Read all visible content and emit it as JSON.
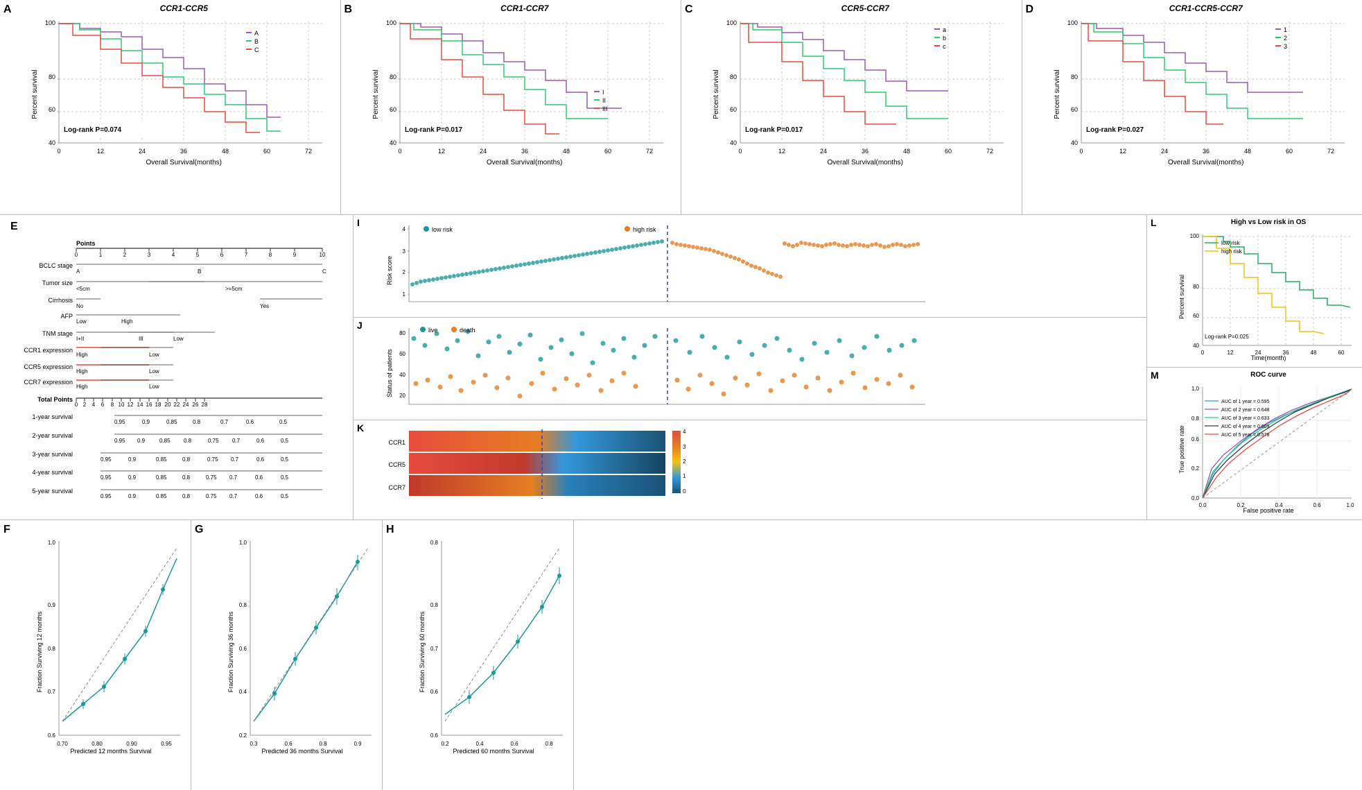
{
  "panels": {
    "A": {
      "label": "A",
      "title": "CCR1-CCR5",
      "pvalue": "Log-rank P=0.074",
      "xaxis": "Overall Survival(months)",
      "yaxis": "Percent survival",
      "legend": [
        "A",
        "B",
        "C"
      ],
      "legend_colors": [
        "#9b59b6",
        "#2ecc71",
        "#e74c3c"
      ],
      "xticks": [
        0,
        12,
        24,
        36,
        48,
        60,
        72
      ],
      "yticks": [
        40,
        60,
        80,
        100
      ]
    },
    "B": {
      "label": "B",
      "title": "CCR1-CCR7",
      "pvalue": "Log-rank P=0.017",
      "xaxis": "Overall Survival(months)",
      "yaxis": "Percent survival",
      "legend": [
        "I",
        "II",
        "III"
      ],
      "legend_colors": [
        "#9b59b6",
        "#2ecc71",
        "#e74c3c"
      ],
      "xticks": [
        0,
        12,
        24,
        36,
        48,
        60,
        72
      ],
      "yticks": [
        40,
        60,
        80,
        100
      ]
    },
    "C": {
      "label": "C",
      "title": "CCR5-CCR7",
      "pvalue": "Log-rank P=0.017",
      "xaxis": "Overall Survival(months)",
      "yaxis": "Percent survival",
      "legend": [
        "a",
        "b",
        "c"
      ],
      "legend_colors": [
        "#9b59b6",
        "#2ecc71",
        "#e74c3c"
      ],
      "xticks": [
        0,
        12,
        24,
        36,
        48,
        60,
        72
      ],
      "yticks": [
        40,
        60,
        80,
        100
      ]
    },
    "D": {
      "label": "D",
      "title": "CCR1-CCR5-CCR7",
      "pvalue": "Log-rank P=0.027",
      "xaxis": "Overall Survival(months)",
      "yaxis": "Percent survival",
      "legend": [
        "1",
        "2",
        "3"
      ],
      "legend_colors": [
        "#9b59b6",
        "#2ecc71",
        "#e74c3c"
      ],
      "xticks": [
        0,
        12,
        24,
        36,
        48,
        60,
        72
      ],
      "yticks": [
        40,
        60,
        80,
        100
      ]
    },
    "E": {
      "label": "E",
      "rows": [
        {
          "name": "Points",
          "scale": "0-10",
          "type": "scale"
        },
        {
          "name": "BCLC stage",
          "items": [
            "A",
            "B",
            "C"
          ],
          "type": "categorical"
        },
        {
          "name": "Tumor size",
          "items": [
            "<5cm",
            ">=5cm"
          ],
          "type": "categorical"
        },
        {
          "name": "Cirrhosis",
          "items": [
            "No",
            "Yes"
          ],
          "type": "categorical"
        },
        {
          "name": "AFP",
          "items": [
            "Low",
            "High"
          ],
          "type": "categorical"
        },
        {
          "name": "TNM stage",
          "items": [
            "I+II",
            "III"
          ],
          "type": "categorical"
        },
        {
          "name": "CCR1 expression",
          "items": [
            "High",
            "Low"
          ],
          "type": "categorical"
        },
        {
          "name": "CCR5 expression",
          "items": [
            "High",
            "Low"
          ],
          "type": "categorical"
        },
        {
          "name": "CCR7 expression",
          "items": [
            "High",
            "Low"
          ],
          "type": "categorical"
        },
        {
          "name": "Total Points",
          "scale": "0-28",
          "type": "total"
        },
        {
          "name": "1-year survival",
          "values": [
            "0.95",
            "0.9",
            "0.85",
            "0.8",
            "0.7",
            "0.6",
            "0.5"
          ],
          "type": "survival"
        },
        {
          "name": "2-year survival",
          "values": [
            "0.95",
            "0.9",
            "0.85",
            "0.8",
            "0.75",
            "0.7",
            "0.6",
            "0.5"
          ],
          "type": "survival"
        },
        {
          "name": "3-year survival",
          "values": [
            "0.95",
            "0.9",
            "0.85",
            "0.8",
            "0.75",
            "0.7",
            "0.6",
            "0.5"
          ],
          "type": "survival"
        },
        {
          "name": "4-year survival",
          "values": [
            "0.95",
            "0.9",
            "0.85",
            "0.8",
            "0.75",
            "0.7",
            "0.6",
            "0.5"
          ],
          "type": "survival"
        },
        {
          "name": "5-year survival",
          "values": [
            "0.95",
            "0.9",
            "0.85",
            "0.8",
            "0.75",
            "0.7",
            "0.6",
            "0.5"
          ],
          "type": "survival"
        }
      ]
    },
    "I": {
      "label": "I",
      "title": "Risk score",
      "legend": [
        "low risk",
        "high risk"
      ],
      "legend_colors": [
        "#1a9999",
        "#e67e22"
      ]
    },
    "J": {
      "label": "J",
      "title": "Status of patients",
      "legend": [
        "live",
        "death"
      ],
      "legend_colors": [
        "#1a9999",
        "#e67e22"
      ]
    },
    "K": {
      "label": "K",
      "genes": [
        "CCR1",
        "CCR5",
        "CCR7"
      ],
      "legend_values": [
        0,
        1,
        2,
        3,
        4
      ]
    },
    "L": {
      "label": "L",
      "title": "High vs Low risk in OS",
      "pvalue": "Log-rank P=0.025",
      "xaxis": "Time(month)",
      "yaxis": "Percent survival",
      "legend": [
        "low risk",
        "high risk"
      ],
      "legend_colors": [
        "#27ae60",
        "#f1c40f"
      ]
    },
    "M": {
      "label": "M",
      "title": "ROC curve",
      "xaxis": "False positive rate",
      "yaxis": "True positive rate",
      "auc_values": [
        {
          "year": 1,
          "auc": 0.595,
          "color": "#3498db"
        },
        {
          "year": 2,
          "auc": 0.648,
          "color": "#9b59b6"
        },
        {
          "year": 3,
          "auc": 0.633,
          "color": "#2ecc71"
        },
        {
          "year": 4,
          "auc": 0.609,
          "color": "#2c3e50"
        },
        {
          "year": 5,
          "auc": 0.578,
          "color": "#e74c3c"
        }
      ]
    },
    "F": {
      "label": "F",
      "xaxis": "Predicted 12 months Survival",
      "yaxis": "Fraction Surviving 12 months"
    },
    "G": {
      "label": "G",
      "xaxis": "Predicted 36 months Survival",
      "yaxis": "Fraction Surviving 36 months"
    },
    "H": {
      "label": "H",
      "xaxis": "Predicted 60 months Survival",
      "yaxis": "Fraction Surviving 60 months"
    }
  }
}
